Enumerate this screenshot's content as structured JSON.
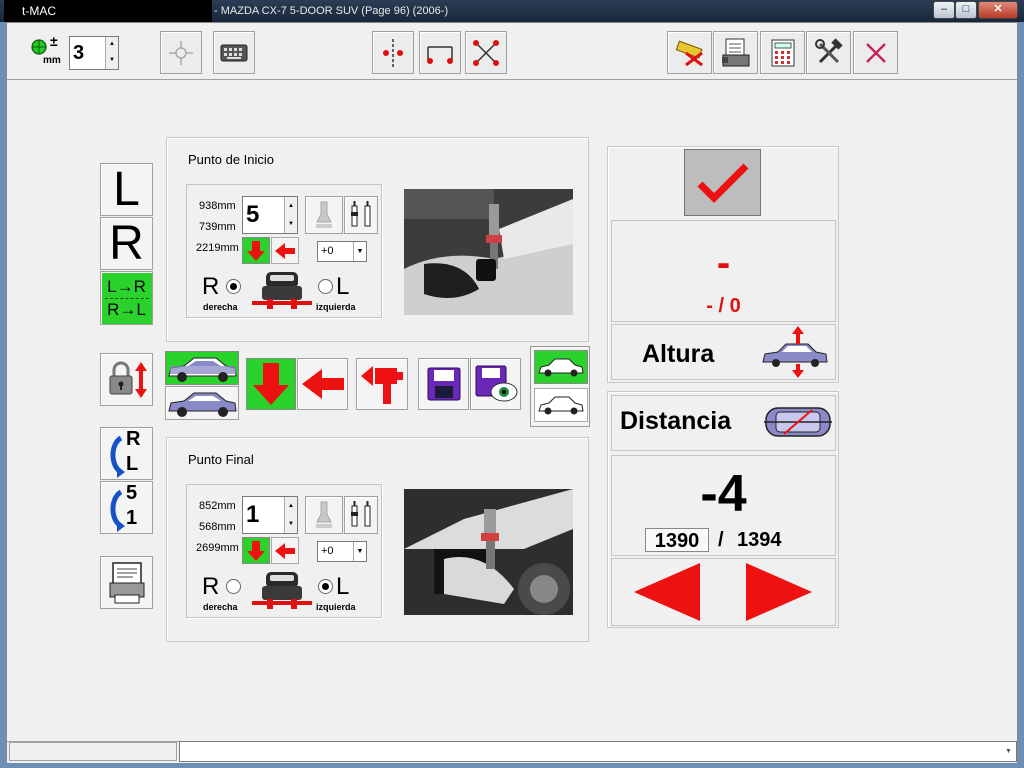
{
  "window": {
    "app_title": "t-MAC",
    "document_title": "- MAZDA CX-7 5-DOOR SUV (Page 96) (2006-)",
    "minimize": "–",
    "maximize": "□",
    "close": "✕"
  },
  "toolbar": {
    "tolerance_value": "3",
    "tolerance_symbol": "±",
    "tolerance_unit": "mm"
  },
  "left_tools": {
    "L": "L",
    "R": "R",
    "lr_line1": "L→R",
    "lr_line2": "R→L",
    "swap_rl_top": "R",
    "swap_rl_bottom": "L",
    "swap_51_top": "5",
    "swap_51_bottom": "1"
  },
  "start_point": {
    "title": "Punto de Inicio",
    "meas1": "938mm",
    "meas2": "739mm",
    "meas3": "2219mm",
    "point_value": "5",
    "offset_value": "+0",
    "right_letter": "R",
    "right_label": "derecha",
    "left_letter": "L",
    "left_label": "izquierda",
    "selected_side": "right"
  },
  "end_point": {
    "title": "Punto Final",
    "meas1": "852mm",
    "meas2": "568mm",
    "meas3": "2699mm",
    "point_value": "1",
    "offset_value": "+0",
    "right_letter": "R",
    "right_label": "derecha",
    "left_letter": "L",
    "left_label": "izquierda",
    "selected_side": "left"
  },
  "height_panel": {
    "value": "-",
    "ratio": "- / 0",
    "label": "Altura"
  },
  "distance_panel": {
    "label": "Distancia",
    "value": "-4",
    "measured": "1390",
    "separator": "/",
    "reference": "1394"
  },
  "colors": {
    "accent_green": "#2cd22c",
    "arrow_red": "#ee1111",
    "value_red": "#e01010",
    "panel_bg": "#f0f0f0"
  },
  "icons": [
    "tolerance-icon",
    "crosshair-icon",
    "keyboard-icon",
    "vertical-measure-icon",
    "horizontal-measure-icon",
    "diagonal-measure-icon",
    "ruler-delete-icon",
    "print-setup-icon",
    "calculator-icon",
    "tools-icon",
    "close-x-icon",
    "lock-height-icon",
    "car-side-icon",
    "down-arrow-icon",
    "left-arrow-icon",
    "attachment-icon",
    "save-icon",
    "save-view-icon",
    "checkmark-icon",
    "car-height-icon",
    "car-distance-icon",
    "report-icon"
  ],
  "status": {
    "left": "",
    "right": ""
  }
}
